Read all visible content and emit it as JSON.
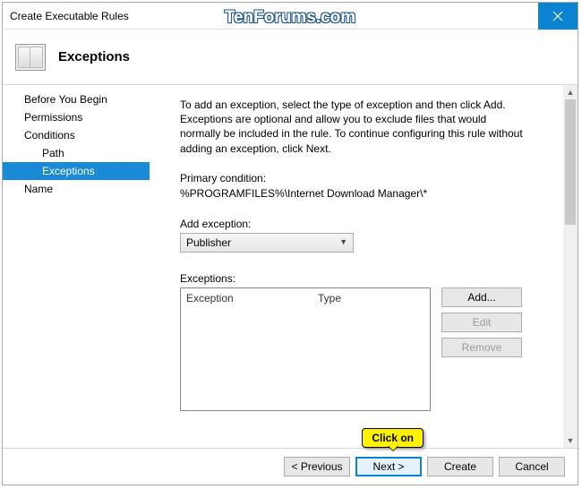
{
  "window": {
    "title": "Create Executable Rules"
  },
  "header": {
    "title": "Exceptions"
  },
  "sidebar": {
    "items": [
      {
        "label": "Before You Begin"
      },
      {
        "label": "Permissions"
      },
      {
        "label": "Conditions"
      },
      {
        "label": "Path"
      },
      {
        "label": "Exceptions"
      },
      {
        "label": "Name"
      }
    ]
  },
  "main": {
    "description": "To add an exception, select the type of exception and then click Add. Exceptions are optional and allow you to exclude files that would normally be included in the rule. To continue configuring this rule without adding an exception, click Next.",
    "primary_label": "Primary condition:",
    "primary_value": "%PROGRAMFILES%\\Internet Download Manager\\*",
    "add_label": "Add exception:",
    "dropdown_value": "Publisher",
    "exceptions_label": "Exceptions:",
    "col_exception": "Exception",
    "col_type": "Type",
    "btn_add": "Add...",
    "btn_edit": "Edit",
    "btn_remove": "Remove"
  },
  "footer": {
    "previous": "< Previous",
    "next": "Next >",
    "create": "Create",
    "cancel": "Cancel"
  },
  "callout": "Click on",
  "watermark": "TenForums.com"
}
